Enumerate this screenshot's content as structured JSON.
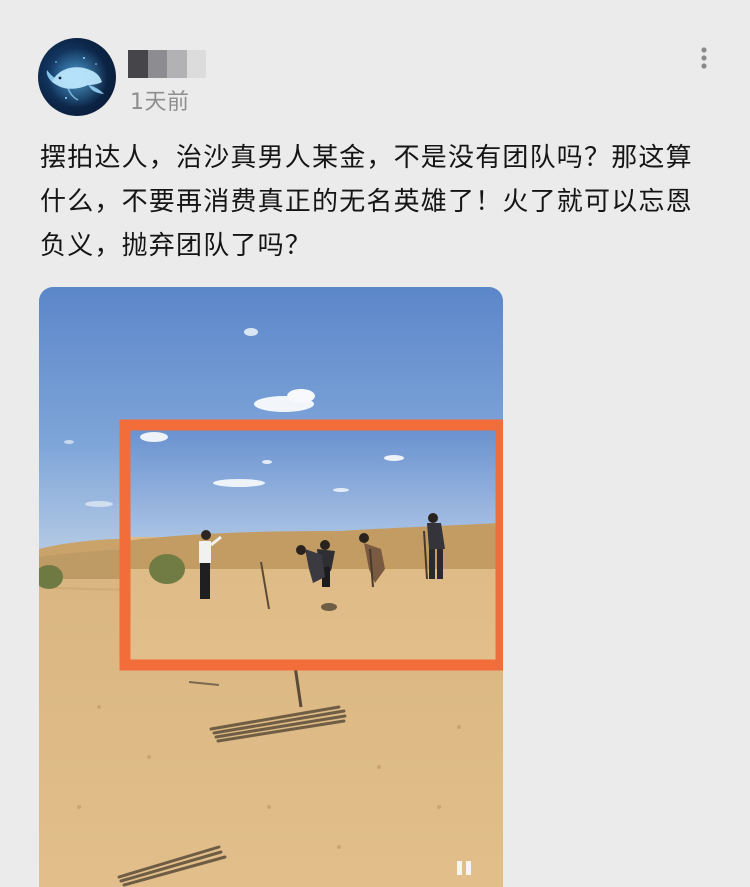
{
  "post": {
    "timestamp": "1天前",
    "text": "摆拍达人，治沙真男人某金，不是没有团队吗？那这算什么，不要再消费真正的无名英雄了！火了就可以忘恩负义，抛弃团队了吗？"
  },
  "author": {
    "avatar_icon": "whale-icon",
    "name_mosaic_colors": [
      "#45454a",
      "#8d8d91",
      "#b2b2b5",
      "#dcdcdc"
    ]
  },
  "menu": {
    "icon": "more-vertical-icon"
  },
  "media": {
    "highlight_color": "#f26d3a"
  }
}
